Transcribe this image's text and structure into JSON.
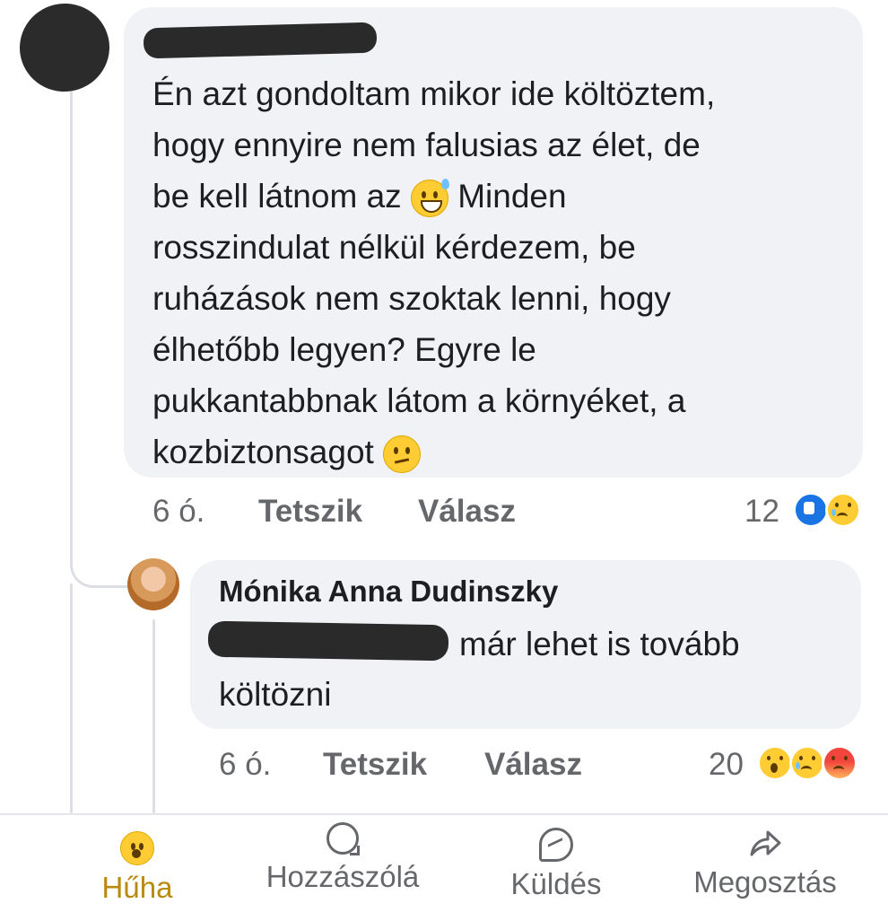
{
  "comment": {
    "text_line1": "Én azt gondoltam mikor ide költöztem,",
    "text_line2": "hogy ennyire nem falusias az élet, de",
    "text_line3a": "be kell látnom az",
    "text_line3b": "Minden",
    "text_line4": "rosszindulat nélkül kérdezem, be",
    "text_line5": "ruházások nem szoktak lenni, hogy",
    "text_line6": "élhetőbb legyen? Egyre le",
    "text_line7": "pukkantabbnak látom a környéket, a",
    "text_line8": "kozbiztonsagot",
    "time": "6 ó.",
    "like_label": "Tetszik",
    "reply_label": "Válasz",
    "reaction_count": "12",
    "reactions": [
      "like",
      "sad"
    ]
  },
  "reply": {
    "author": "Mónika Anna Dudinszky",
    "text_line1": "már lehet is tovább",
    "text_line2": "költözni",
    "time": "6 ó.",
    "like_label": "Tetszik",
    "reply_label": "Válasz",
    "reaction_count": "20",
    "reactions": [
      "wow",
      "sad",
      "angry"
    ]
  },
  "action_bar": {
    "wow_label": "Hűha",
    "comment_label": "Hozzászólá",
    "send_label": "Küldés",
    "share_label": "Megosztás",
    "active_color": "#b88a0f"
  }
}
